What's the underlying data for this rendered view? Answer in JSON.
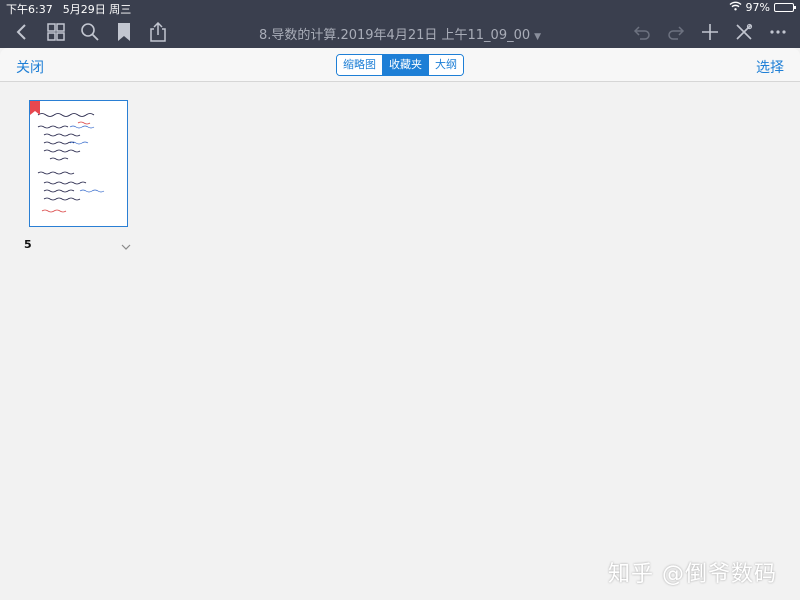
{
  "status_bar": {
    "time": "下午6:37",
    "date": "5月29日 周三",
    "battery_text": "97%",
    "battery_level": 0.97
  },
  "toolbar": {
    "title": "8.导数的计算.2019年4月21日 上午11_09_00",
    "icons": [
      "back-icon",
      "grid-icon",
      "search-icon",
      "bookmark-icon",
      "share-icon",
      "undo-icon",
      "redo-icon",
      "add-icon",
      "tools-icon",
      "more-icon"
    ]
  },
  "sheet": {
    "close_label": "关闭",
    "select_label": "选择",
    "segments": [
      {
        "label": "缩略图",
        "active": false
      },
      {
        "label": "收藏夹",
        "active": true
      },
      {
        "label": "大纲",
        "active": false
      }
    ]
  },
  "thumbnails": [
    {
      "page_number": "5",
      "bookmarked": true
    }
  ],
  "colors": {
    "accent": "#1e7fd6",
    "toolbar_bg": "#3a3f4e",
    "bookmark": "#e8484f"
  },
  "watermark": "知乎 @倒爷数码"
}
